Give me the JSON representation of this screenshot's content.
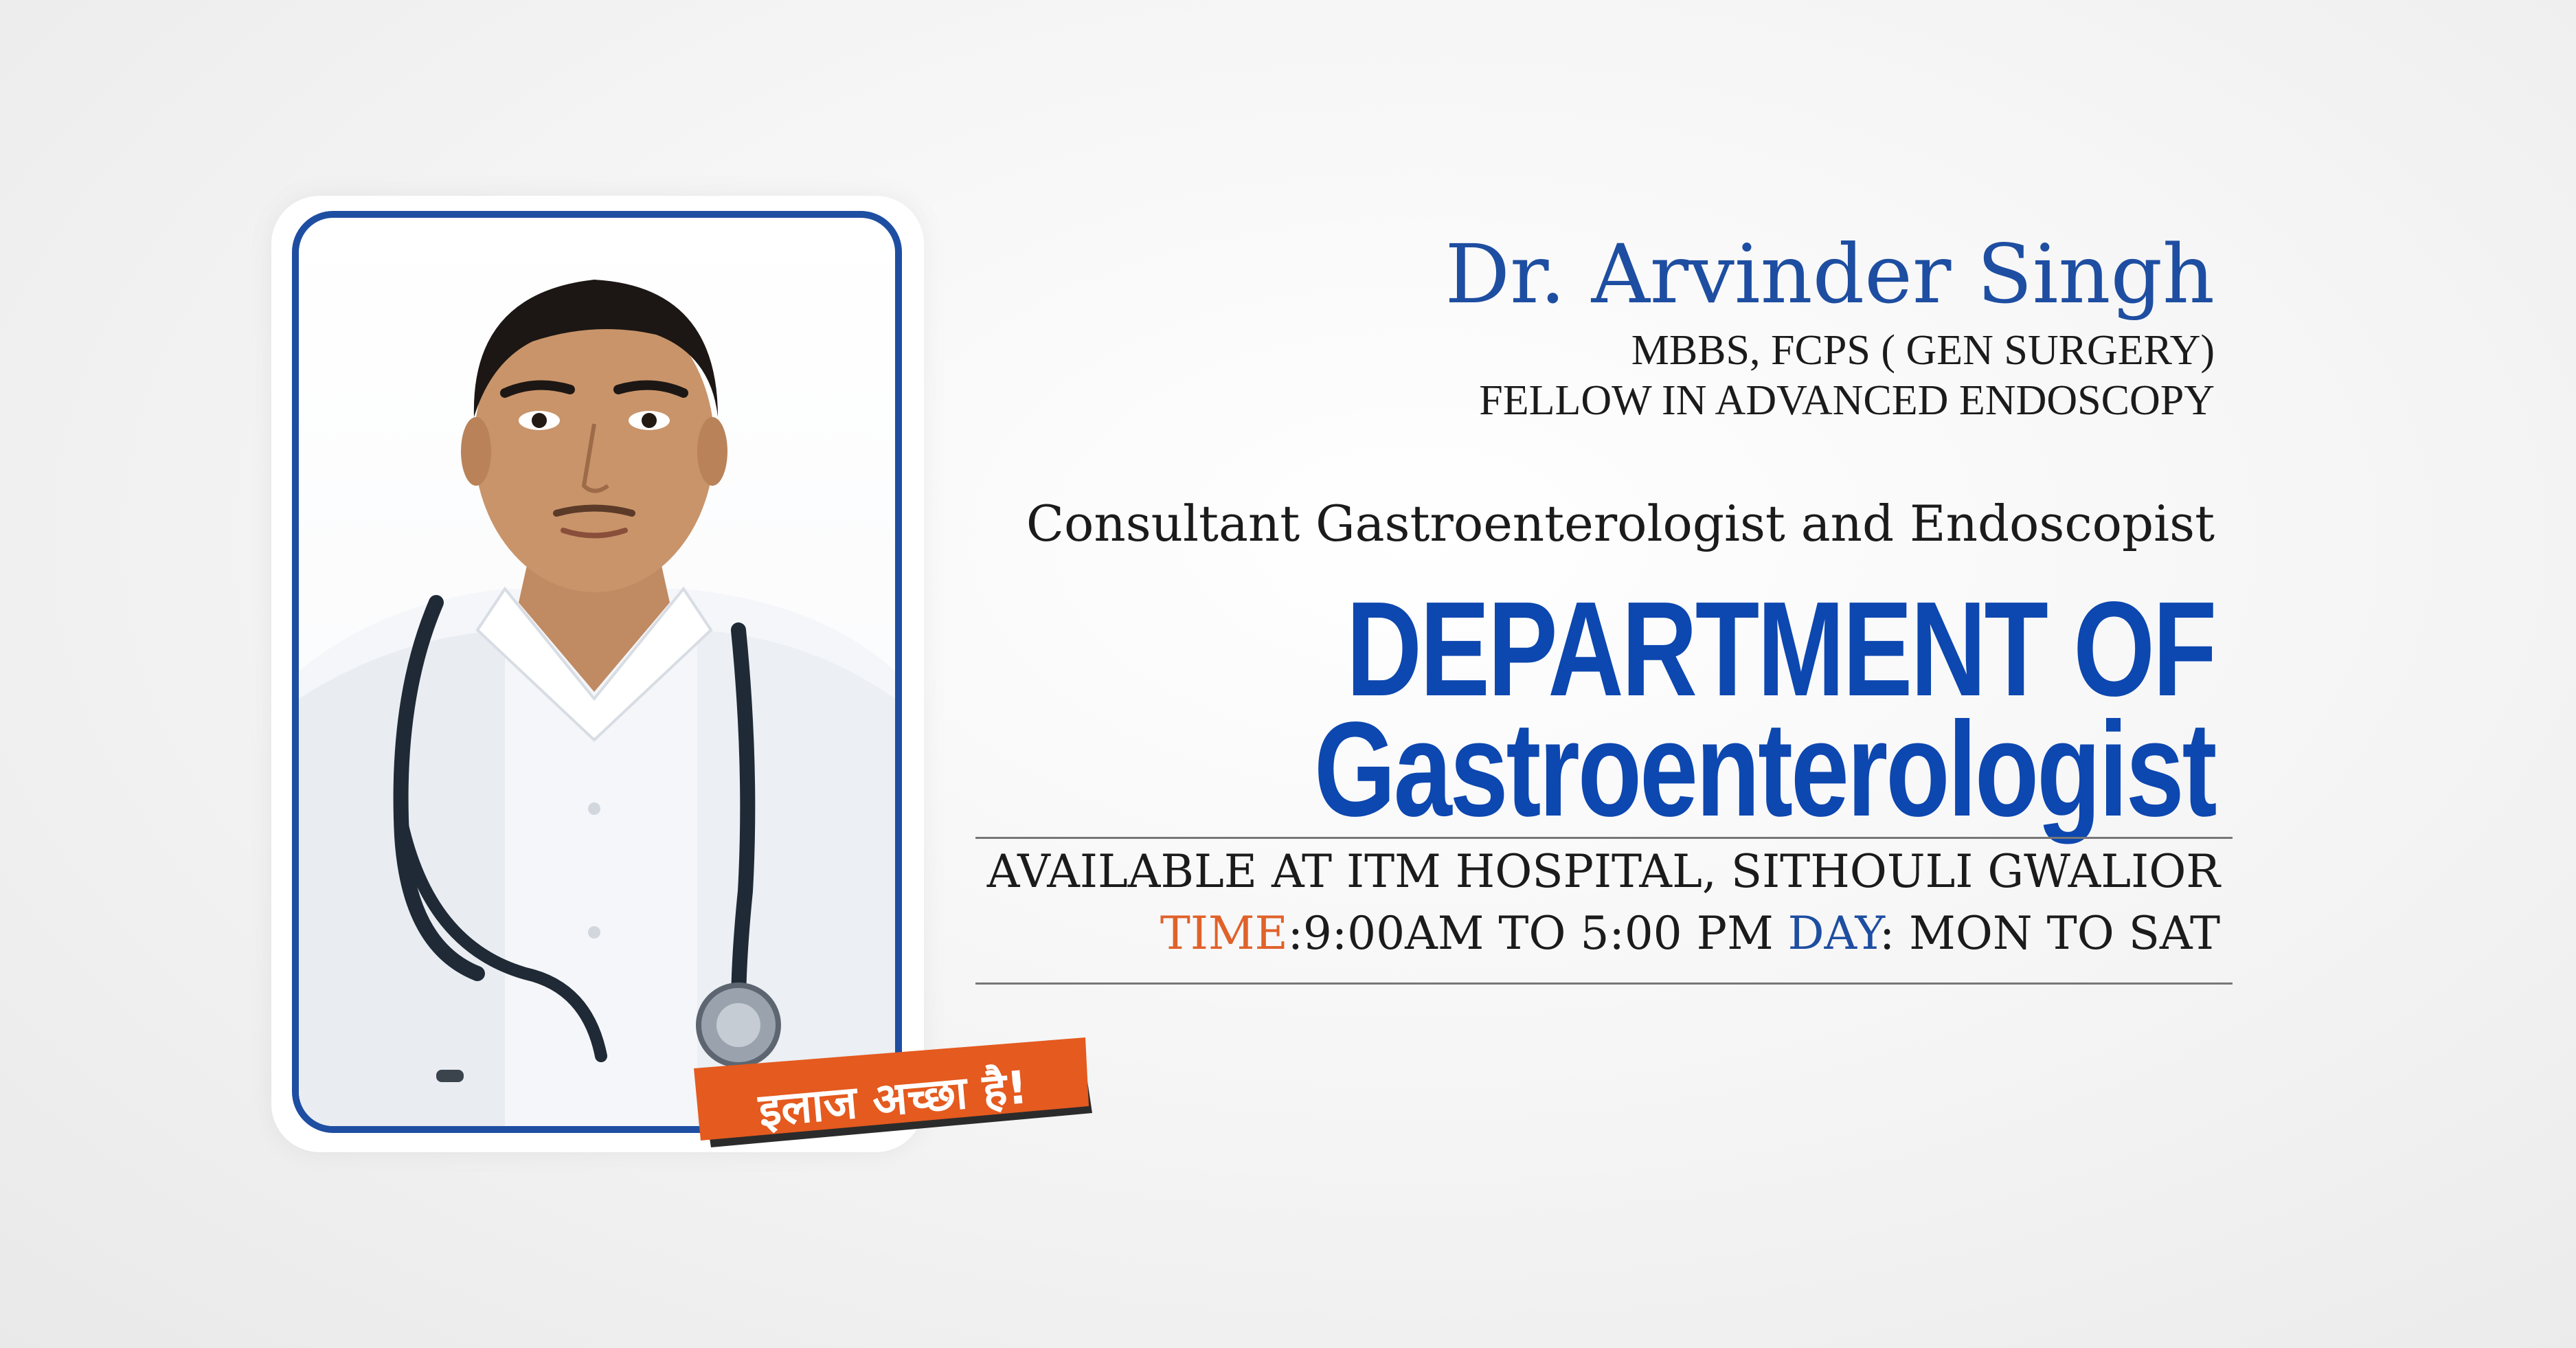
{
  "doctor": {
    "name": "Dr. Arvinder Singh",
    "qualification_line1": "MBBS, FCPS ( GEN SURGERY)",
    "qualification_line2": "FELLOW IN ADVANCED ENDOSCOPY",
    "role": "Consultant Gastroenterologist and Endoscopist"
  },
  "department": {
    "line1": "DEPARTMENT OF",
    "line2": "Gastroenterologist"
  },
  "availability": {
    "location": "AVAILABLE AT ITM HOSPITAL, SITHOULI GWALIOR",
    "time_label": "TIME",
    "time_value": ":9:00AM TO 5:00 PM",
    "day_label": "DAY",
    "day_value": ": MON TO SAT"
  },
  "badge": {
    "text": "इलाज अच्छा है!"
  },
  "colors": {
    "brand_blue": "#1e4ea1",
    "heading_blue": "#0d47b0",
    "accent_orange": "#e0622a"
  },
  "icons": {
    "portrait": "doctor-portrait-image",
    "badge": "tagline-badge"
  }
}
